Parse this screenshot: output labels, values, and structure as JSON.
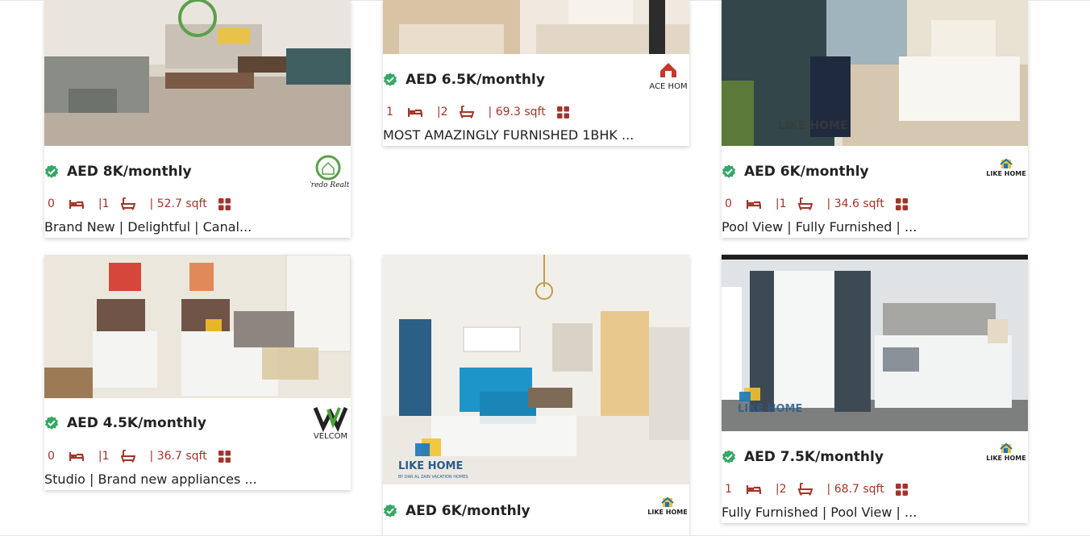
{
  "colors": {
    "accent": "#a2342a",
    "verified": "#34a865",
    "text": "#222222"
  },
  "listings": [
    {
      "price": "AED 8K/monthly",
      "beds": "0",
      "baths": "|1",
      "area": "| 52.7 sqft",
      "description": "Brand New | Delightful | Canal...",
      "agency_logo": "fredo-realty-logo",
      "agency_logo_text": "Fredo Realty"
    },
    {
      "price": "AED 6.5K/monthly",
      "beds": "1",
      "baths": "|2",
      "area": "| 69.3 sqft",
      "description": "MOST AMAZINGLY FURNISHED 1BHK ...",
      "agency_logo": "ace-home-logo",
      "agency_logo_text": "ACE HOM"
    },
    {
      "price": "AED 6K/monthly",
      "beds": "0",
      "baths": "|1",
      "area": "| 34.6 sqft",
      "description": "Pool View | Fully Furnished | ...",
      "agency_logo": "like-home-logo",
      "agency_logo_text": "LIKE HOME"
    },
    {
      "price": "AED 4.5K/monthly",
      "beds": "0",
      "baths": "|1",
      "area": "| 36.7 sqft",
      "description": "Studio | Brand new appliances ...",
      "agency_logo": "welcome-logo",
      "agency_logo_text": "VELCOM"
    },
    {
      "price": "AED 6K/monthly",
      "agency_logo": "like-home-logo",
      "agency_logo_text": "LIKE HOME",
      "watermark": "LIKE HOME",
      "watermark_sub": "BY DAR AL ZAIN VACATION HOMES"
    },
    {
      "price": "AED 7.5K/monthly",
      "beds": "1",
      "baths": "|2",
      "area": "| 68.7 sqft",
      "description": "Fully Furnished | Pool View | ...",
      "agency_logo": "like-home-logo",
      "agency_logo_text": "LIKE HOME",
      "watermark": "LIKE HOME"
    }
  ]
}
